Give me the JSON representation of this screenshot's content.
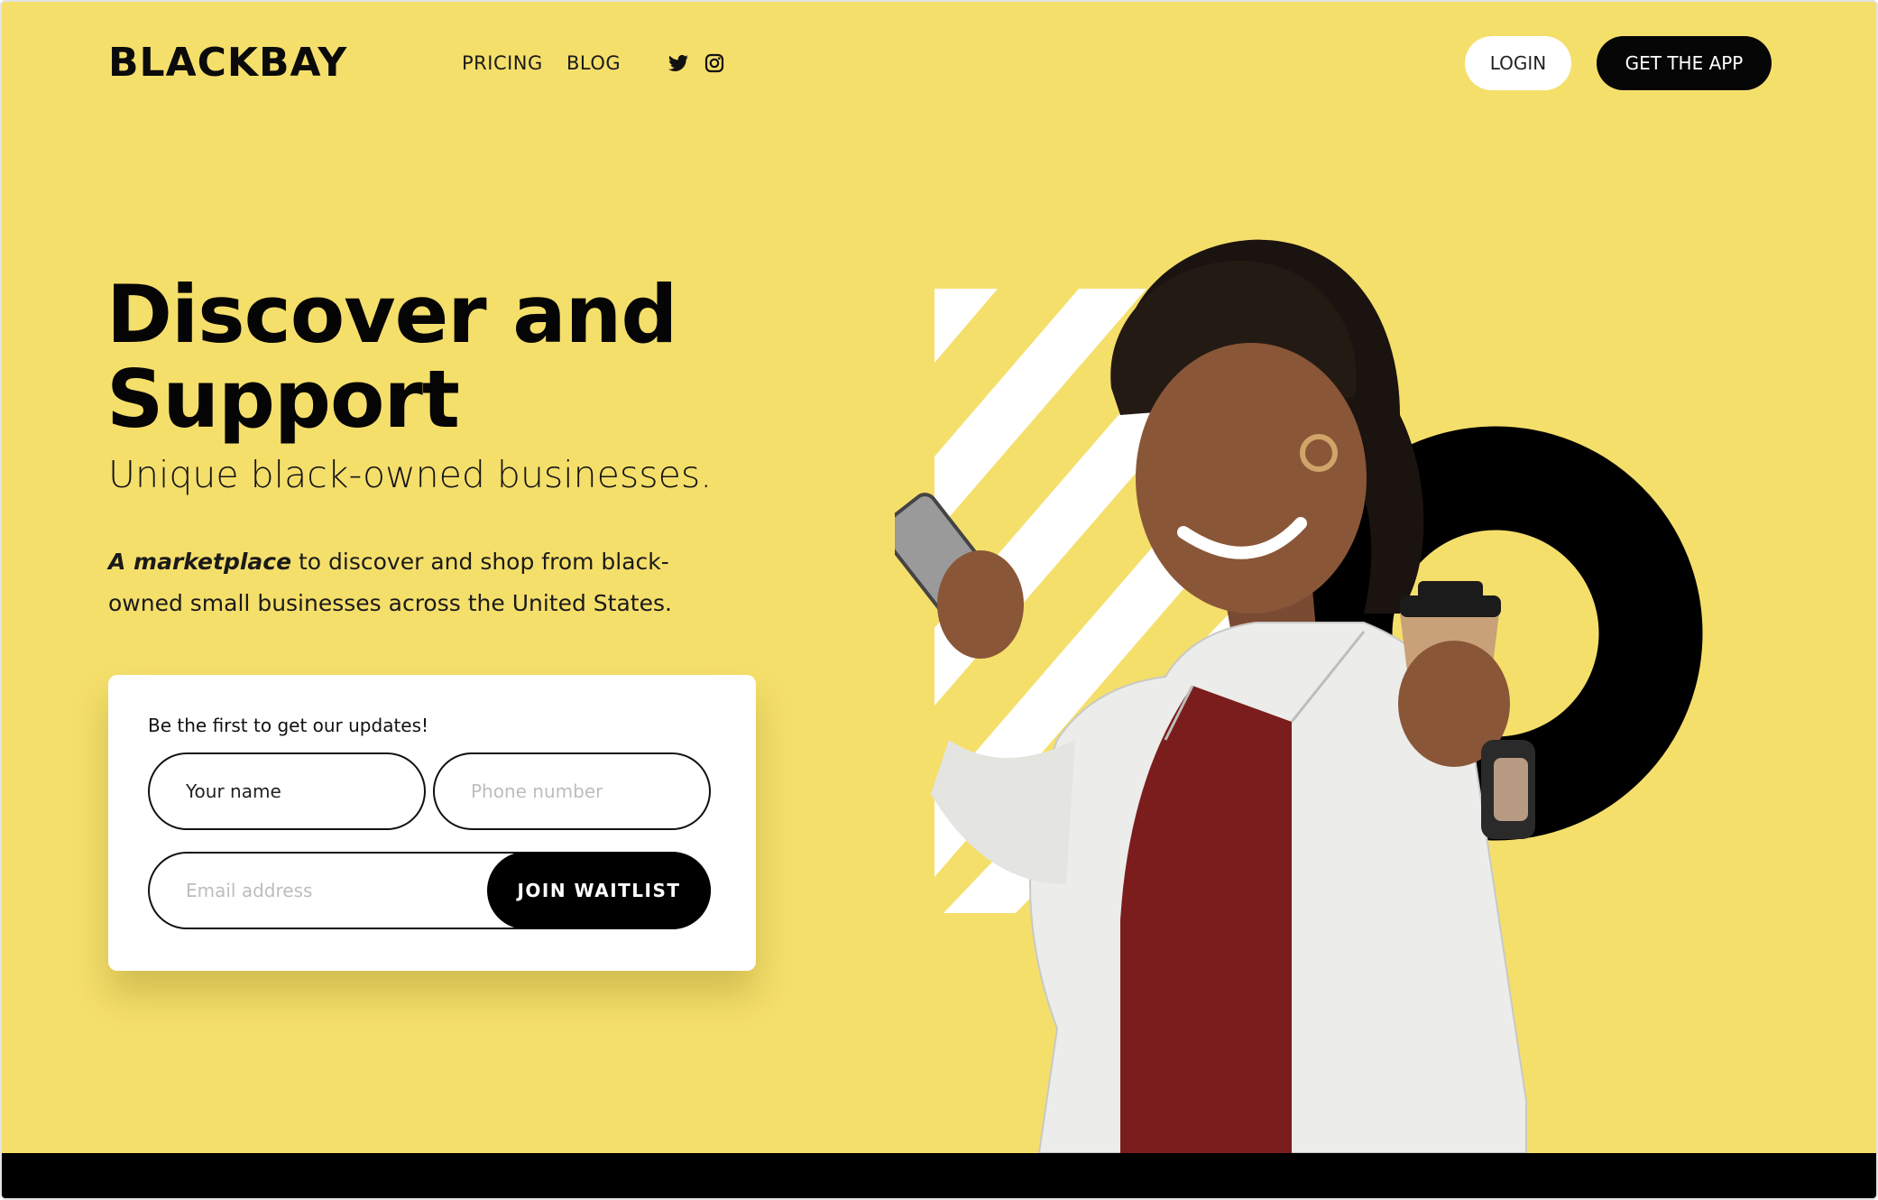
{
  "brand": {
    "logo": "BLACKBAY"
  },
  "nav": {
    "links": [
      "PRICING",
      "BLOG"
    ],
    "login": "LOGIN",
    "get_app": "GET THE APP",
    "social_icons": [
      "twitter-icon",
      "instagram-icon"
    ]
  },
  "hero": {
    "title_line1": "Discover and",
    "title_line2": "Support",
    "subtitle": "Unique black-owned businesses.",
    "desc_em": "A marketplace",
    "desc_rest": " to discover and shop from black-owned small businesses across the United States."
  },
  "form": {
    "label": "Be the first to get our updates!",
    "name_placeholder": "Your name",
    "phone_placeholder": "Phone number",
    "email_placeholder": "Email address",
    "submit": "JOIN WAITLIST"
  },
  "colors": {
    "background": "#f5df6b",
    "primary": "#000000",
    "card": "#ffffff"
  }
}
